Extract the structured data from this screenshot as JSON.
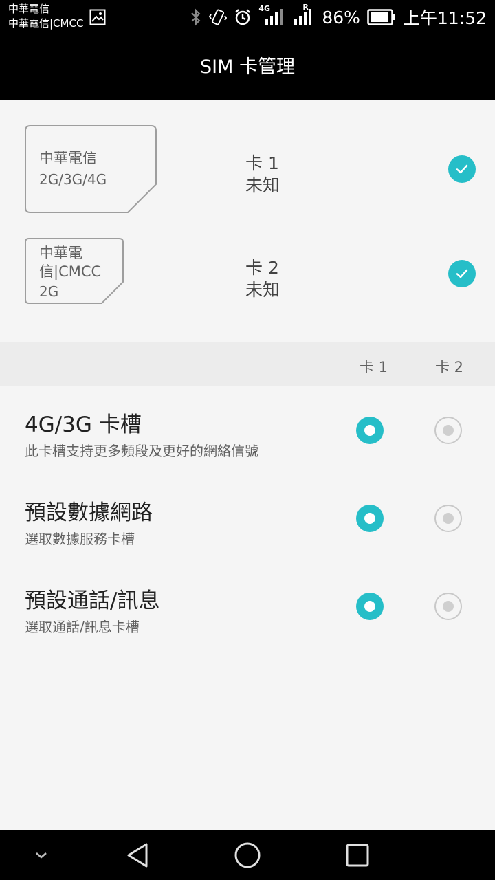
{
  "status_bar": {
    "carrier_1": "中華電信",
    "carrier_2": "中華電信|CMCC",
    "network_type": "4G",
    "roaming_indicator": "R",
    "battery_percent": "86%",
    "time": "上午11:52",
    "icons": [
      "gallery-icon",
      "bluetooth-icon",
      "vibrate-icon",
      "alarm-icon",
      "signal-4g-icon",
      "signal-roaming-icon",
      "battery-icon"
    ]
  },
  "title": "SIM 卡管理",
  "sims": [
    {
      "card_carrier": "中華電信",
      "card_network": "2G/3G/4G",
      "slot_label": "卡 1",
      "status": "未知",
      "enabled": true
    },
    {
      "card_carrier_line1": "中華電",
      "card_carrier_line2": "信|CMCC",
      "card_network": "2G",
      "slot_label": "卡 2",
      "status": "未知",
      "enabled": true
    }
  ],
  "column_headers": [
    "卡 1",
    "卡 2"
  ],
  "settings": [
    {
      "title": "4G/3G 卡槽",
      "subtitle": "此卡槽支持更多頻段及更好的網絡信號",
      "selected": "卡 1"
    },
    {
      "title": "預設數據網路",
      "subtitle": "選取數據服務卡槽",
      "selected": "卡 1"
    },
    {
      "title": "預設通話/訊息",
      "subtitle": "選取通話/訊息卡槽",
      "selected": "卡 1"
    }
  ],
  "accent_color": "#26bec8",
  "nav_bar": [
    "hide-keyboard-icon",
    "back-icon",
    "home-icon",
    "recents-icon"
  ]
}
